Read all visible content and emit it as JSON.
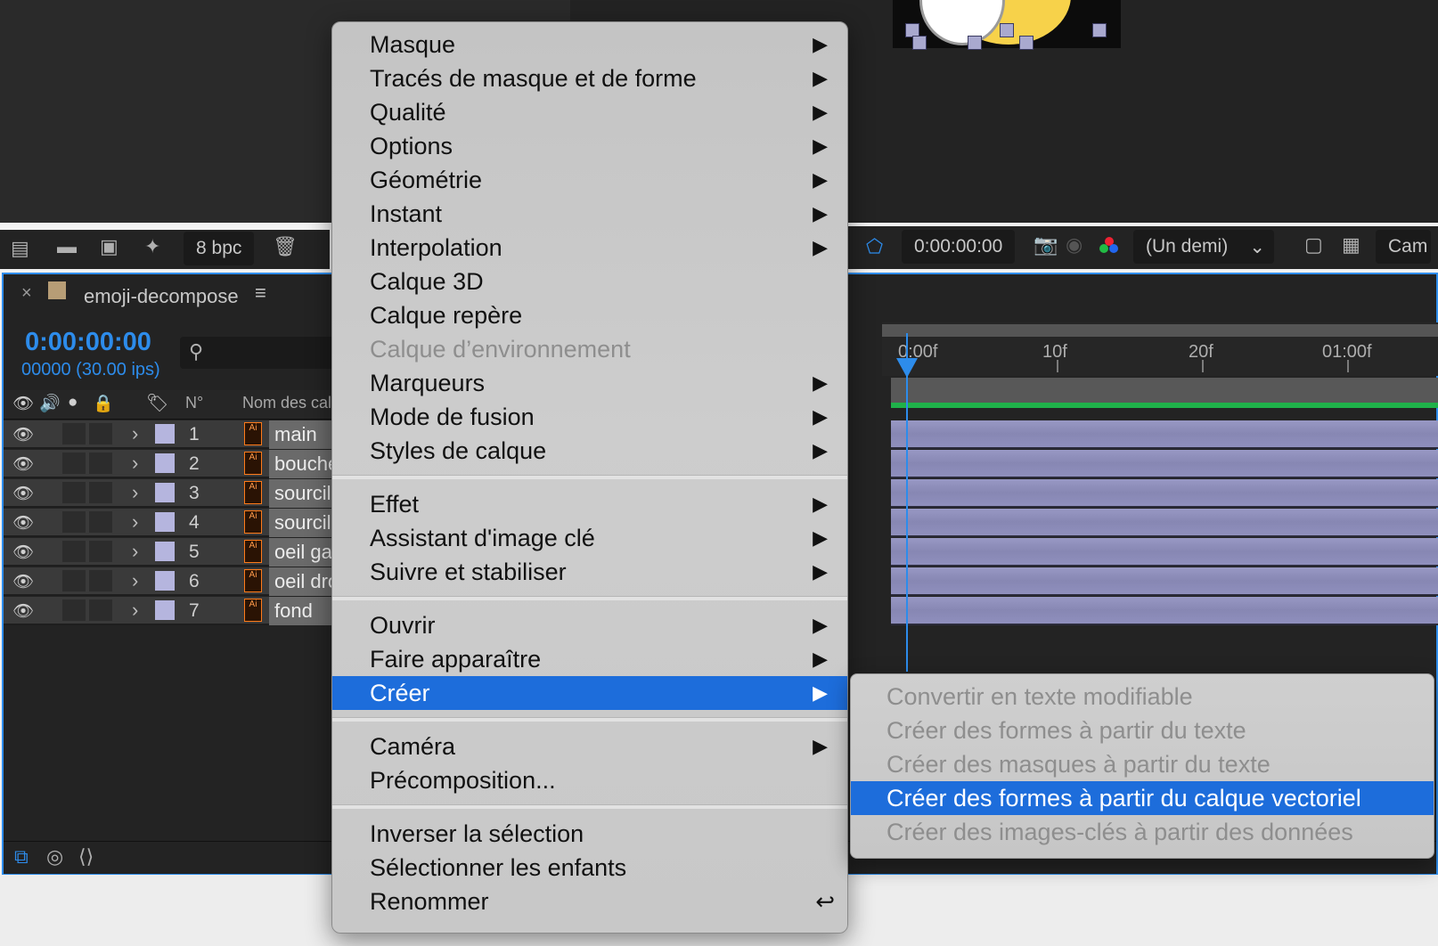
{
  "project_toolbar": {
    "bit_depth": "8 bpc"
  },
  "viewer_toolbar": {
    "timecode": "0:00:00:00",
    "resolution": "(Un demi)",
    "camera_label": "Cam"
  },
  "timeline": {
    "comp_name": "emoji-decompose",
    "current_time": "0:00:00:00",
    "frame_info": "00000 (30.00 ips)",
    "col_num": "N°",
    "col_name": "Nom des calques",
    "layers": [
      {
        "num": "1",
        "name": "main",
        "ai": "Ai"
      },
      {
        "num": "2",
        "name": "bouche",
        "ai": "Ai"
      },
      {
        "num": "3",
        "name": "sourcil gauche",
        "ai": "Ai"
      },
      {
        "num": "4",
        "name": "sourcil droit",
        "ai": "Ai"
      },
      {
        "num": "5",
        "name": "oeil gauche",
        "ai": "Ai"
      },
      {
        "num": "6",
        "name": "oeil droit",
        "ai": "Ai"
      },
      {
        "num": "7",
        "name": "fond",
        "ai": "Ai"
      }
    ],
    "ruler_ticks": [
      "0:00f",
      "10f",
      "20f",
      "01:00f"
    ],
    "layer_color": "#b5b5de",
    "accent_color": "#2d8ceb"
  },
  "context_menu": {
    "items": [
      {
        "label": "Masque",
        "submenu": true
      },
      {
        "label": "Tracés de masque et de forme",
        "submenu": true
      },
      {
        "label": "Qualité",
        "submenu": true
      },
      {
        "label": "Options",
        "submenu": true
      },
      {
        "label": "Géométrie",
        "submenu": true
      },
      {
        "label": "Instant",
        "submenu": true
      },
      {
        "label": "Interpolation",
        "submenu": true
      },
      {
        "label": "Calque 3D",
        "submenu": false
      },
      {
        "label": "Calque repère",
        "submenu": false
      },
      {
        "label": "Calque d’environnement",
        "submenu": false,
        "disabled": true
      },
      {
        "label": "Marqueurs",
        "submenu": true
      },
      {
        "label": "Mode de fusion",
        "submenu": true
      },
      {
        "label": "Styles de calque",
        "submenu": true
      },
      {
        "label": "Effet",
        "submenu": true
      },
      {
        "label": "Assistant d'image clé",
        "submenu": true
      },
      {
        "label": "Suivre et stabiliser",
        "submenu": true
      },
      {
        "label": "Ouvrir",
        "submenu": true
      },
      {
        "label": "Faire apparaître",
        "submenu": true
      },
      {
        "label": "Créer",
        "submenu": true,
        "selected": true
      },
      {
        "label": "Caméra",
        "submenu": true
      },
      {
        "label": "Précomposition...",
        "submenu": false
      },
      {
        "label": "Inverser la sélection",
        "submenu": false
      },
      {
        "label": "Sélectionner les enfants",
        "submenu": false
      },
      {
        "label": "Renommer",
        "submenu": false,
        "return_glyph": "↩"
      }
    ],
    "submenu_arrow": "▶",
    "selection_color": "#1d6ddb"
  },
  "create_submenu": {
    "items": [
      {
        "label": "Convertir en texte modifiable",
        "disabled": true
      },
      {
        "label": "Créer des formes à partir du texte",
        "disabled": true
      },
      {
        "label": "Créer des masques à partir du texte",
        "disabled": true
      },
      {
        "label": "Créer des formes à partir du calque vectoriel",
        "selected": true
      },
      {
        "label": "Créer des images-clés à partir des données",
        "disabled": true
      }
    ]
  }
}
